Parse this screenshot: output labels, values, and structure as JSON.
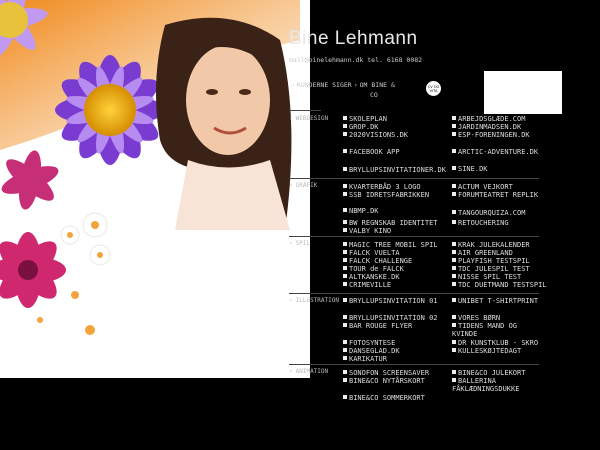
{
  "site": {
    "title": "Bine Lehmann",
    "contact": "mail@binelehmann.dk   tel. 6168 0082"
  },
  "nav": {
    "item1": "KUNDERNE SIGER",
    "item2_line1": "OM BINE &",
    "item2_line2": "CO",
    "badge": "CV OG VITA"
  },
  "sections": {
    "webdesign": "WEBDESIGN",
    "grafik": "GRAFIK",
    "spil": "SPIL",
    "illustration": "ILLUSTRATION",
    "animation": "ANIMATION"
  },
  "webdesign": {
    "left": [
      "SKOLEPLAN",
      "GROP.DK",
      "2020VISIONS.DK",
      "FACEBOOK APP",
      "BRYLLUPSINVITATIONER.DK"
    ],
    "right": [
      "ARBEJDSGLÆDE.COM",
      "JARDINMADSEN.DK",
      "ESP-FORENINGEN.DK",
      "ARCTIC-ADVENTURE.DK",
      "SINE.DK"
    ]
  },
  "grafik": {
    "left": [
      "KVARTERBÅD 3 LOGO",
      "SSB IDRETSFABRIKKEN",
      "NBMP.DK",
      "BW REGNSKAB IDENTITET",
      "VALBY KINO"
    ],
    "right": [
      "ACTUM VEJKORT",
      "FORUMTEATRET REPLIK",
      "TANGOURQUIZA.COM",
      "RETOUCHERING"
    ]
  },
  "spil": {
    "left": [
      "MAGIC TREE MOBIL SPIL",
      "FALCK VUELTA",
      "FALCK CHALLENGE",
      "TOUR de FALCK",
      "ALTKANSKE.DK",
      "CRIMEVILLE"
    ],
    "right": [
      "KRAK JULEKALENDER",
      "AIR GREENLAND",
      "PLAYFISH TESTSPIL",
      "TDC JULESPIL TEST",
      "NISSE SPIL TEST",
      "TDC DUETMAND TESTSPIL"
    ]
  },
  "illustration": {
    "left": [
      "BRYLLUPSINVITATION 01",
      "BRYLLUPSINVITATION 02",
      "BAR ROUGE FLYER",
      "FOTOSYNTESE",
      "DANSEGLAD.DK",
      "KARIKATUR"
    ],
    "right": [
      "UNIBET T-SHIRTPRINT",
      "VORES BØRN",
      "TIDENS MAND OG KVINDE",
      "DR KUNSTKLUB - SKRO",
      "KULLESKØJTEDAGT"
    ]
  },
  "animation": {
    "left": [
      "SONOFON SCREENSAVER",
      "BINE&CO NYTÅRSKORT",
      "BINE&CO SOMMERKORT"
    ],
    "right": [
      "BINE&CO JULEKORT",
      "BALLERINA FÅKLÆDNINGSDUKKE"
    ]
  },
  "colors": {
    "background": "#000000",
    "text": "#dddddd",
    "accent_purple": "#8a3fd0",
    "accent_orange": "#f39a1a"
  }
}
